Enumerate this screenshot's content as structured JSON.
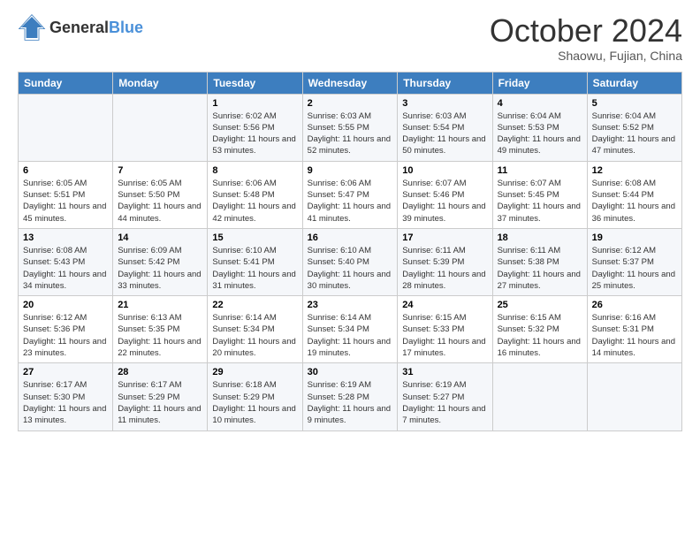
{
  "header": {
    "logo_line1": "General",
    "logo_line2": "Blue",
    "month": "October 2024",
    "location": "Shaowu, Fujian, China"
  },
  "weekdays": [
    "Sunday",
    "Monday",
    "Tuesday",
    "Wednesday",
    "Thursday",
    "Friday",
    "Saturday"
  ],
  "weeks": [
    [
      {
        "day": "",
        "sunrise": "",
        "sunset": "",
        "daylight": ""
      },
      {
        "day": "",
        "sunrise": "",
        "sunset": "",
        "daylight": ""
      },
      {
        "day": "1",
        "sunrise": "Sunrise: 6:02 AM",
        "sunset": "Sunset: 5:56 PM",
        "daylight": "Daylight: 11 hours and 53 minutes."
      },
      {
        "day": "2",
        "sunrise": "Sunrise: 6:03 AM",
        "sunset": "Sunset: 5:55 PM",
        "daylight": "Daylight: 11 hours and 52 minutes."
      },
      {
        "day": "3",
        "sunrise": "Sunrise: 6:03 AM",
        "sunset": "Sunset: 5:54 PM",
        "daylight": "Daylight: 11 hours and 50 minutes."
      },
      {
        "day": "4",
        "sunrise": "Sunrise: 6:04 AM",
        "sunset": "Sunset: 5:53 PM",
        "daylight": "Daylight: 11 hours and 49 minutes."
      },
      {
        "day": "5",
        "sunrise": "Sunrise: 6:04 AM",
        "sunset": "Sunset: 5:52 PM",
        "daylight": "Daylight: 11 hours and 47 minutes."
      }
    ],
    [
      {
        "day": "6",
        "sunrise": "Sunrise: 6:05 AM",
        "sunset": "Sunset: 5:51 PM",
        "daylight": "Daylight: 11 hours and 45 minutes."
      },
      {
        "day": "7",
        "sunrise": "Sunrise: 6:05 AM",
        "sunset": "Sunset: 5:50 PM",
        "daylight": "Daylight: 11 hours and 44 minutes."
      },
      {
        "day": "8",
        "sunrise": "Sunrise: 6:06 AM",
        "sunset": "Sunset: 5:48 PM",
        "daylight": "Daylight: 11 hours and 42 minutes."
      },
      {
        "day": "9",
        "sunrise": "Sunrise: 6:06 AM",
        "sunset": "Sunset: 5:47 PM",
        "daylight": "Daylight: 11 hours and 41 minutes."
      },
      {
        "day": "10",
        "sunrise": "Sunrise: 6:07 AM",
        "sunset": "Sunset: 5:46 PM",
        "daylight": "Daylight: 11 hours and 39 minutes."
      },
      {
        "day": "11",
        "sunrise": "Sunrise: 6:07 AM",
        "sunset": "Sunset: 5:45 PM",
        "daylight": "Daylight: 11 hours and 37 minutes."
      },
      {
        "day": "12",
        "sunrise": "Sunrise: 6:08 AM",
        "sunset": "Sunset: 5:44 PM",
        "daylight": "Daylight: 11 hours and 36 minutes."
      }
    ],
    [
      {
        "day": "13",
        "sunrise": "Sunrise: 6:08 AM",
        "sunset": "Sunset: 5:43 PM",
        "daylight": "Daylight: 11 hours and 34 minutes."
      },
      {
        "day": "14",
        "sunrise": "Sunrise: 6:09 AM",
        "sunset": "Sunset: 5:42 PM",
        "daylight": "Daylight: 11 hours and 33 minutes."
      },
      {
        "day": "15",
        "sunrise": "Sunrise: 6:10 AM",
        "sunset": "Sunset: 5:41 PM",
        "daylight": "Daylight: 11 hours and 31 minutes."
      },
      {
        "day": "16",
        "sunrise": "Sunrise: 6:10 AM",
        "sunset": "Sunset: 5:40 PM",
        "daylight": "Daylight: 11 hours and 30 minutes."
      },
      {
        "day": "17",
        "sunrise": "Sunrise: 6:11 AM",
        "sunset": "Sunset: 5:39 PM",
        "daylight": "Daylight: 11 hours and 28 minutes."
      },
      {
        "day": "18",
        "sunrise": "Sunrise: 6:11 AM",
        "sunset": "Sunset: 5:38 PM",
        "daylight": "Daylight: 11 hours and 27 minutes."
      },
      {
        "day": "19",
        "sunrise": "Sunrise: 6:12 AM",
        "sunset": "Sunset: 5:37 PM",
        "daylight": "Daylight: 11 hours and 25 minutes."
      }
    ],
    [
      {
        "day": "20",
        "sunrise": "Sunrise: 6:12 AM",
        "sunset": "Sunset: 5:36 PM",
        "daylight": "Daylight: 11 hours and 23 minutes."
      },
      {
        "day": "21",
        "sunrise": "Sunrise: 6:13 AM",
        "sunset": "Sunset: 5:35 PM",
        "daylight": "Daylight: 11 hours and 22 minutes."
      },
      {
        "day": "22",
        "sunrise": "Sunrise: 6:14 AM",
        "sunset": "Sunset: 5:34 PM",
        "daylight": "Daylight: 11 hours and 20 minutes."
      },
      {
        "day": "23",
        "sunrise": "Sunrise: 6:14 AM",
        "sunset": "Sunset: 5:34 PM",
        "daylight": "Daylight: 11 hours and 19 minutes."
      },
      {
        "day": "24",
        "sunrise": "Sunrise: 6:15 AM",
        "sunset": "Sunset: 5:33 PM",
        "daylight": "Daylight: 11 hours and 17 minutes."
      },
      {
        "day": "25",
        "sunrise": "Sunrise: 6:15 AM",
        "sunset": "Sunset: 5:32 PM",
        "daylight": "Daylight: 11 hours and 16 minutes."
      },
      {
        "day": "26",
        "sunrise": "Sunrise: 6:16 AM",
        "sunset": "Sunset: 5:31 PM",
        "daylight": "Daylight: 11 hours and 14 minutes."
      }
    ],
    [
      {
        "day": "27",
        "sunrise": "Sunrise: 6:17 AM",
        "sunset": "Sunset: 5:30 PM",
        "daylight": "Daylight: 11 hours and 13 minutes."
      },
      {
        "day": "28",
        "sunrise": "Sunrise: 6:17 AM",
        "sunset": "Sunset: 5:29 PM",
        "daylight": "Daylight: 11 hours and 11 minutes."
      },
      {
        "day": "29",
        "sunrise": "Sunrise: 6:18 AM",
        "sunset": "Sunset: 5:29 PM",
        "daylight": "Daylight: 11 hours and 10 minutes."
      },
      {
        "day": "30",
        "sunrise": "Sunrise: 6:19 AM",
        "sunset": "Sunset: 5:28 PM",
        "daylight": "Daylight: 11 hours and 9 minutes."
      },
      {
        "day": "31",
        "sunrise": "Sunrise: 6:19 AM",
        "sunset": "Sunset: 5:27 PM",
        "daylight": "Daylight: 11 hours and 7 minutes."
      },
      {
        "day": "",
        "sunrise": "",
        "sunset": "",
        "daylight": ""
      },
      {
        "day": "",
        "sunrise": "",
        "sunset": "",
        "daylight": ""
      }
    ]
  ]
}
